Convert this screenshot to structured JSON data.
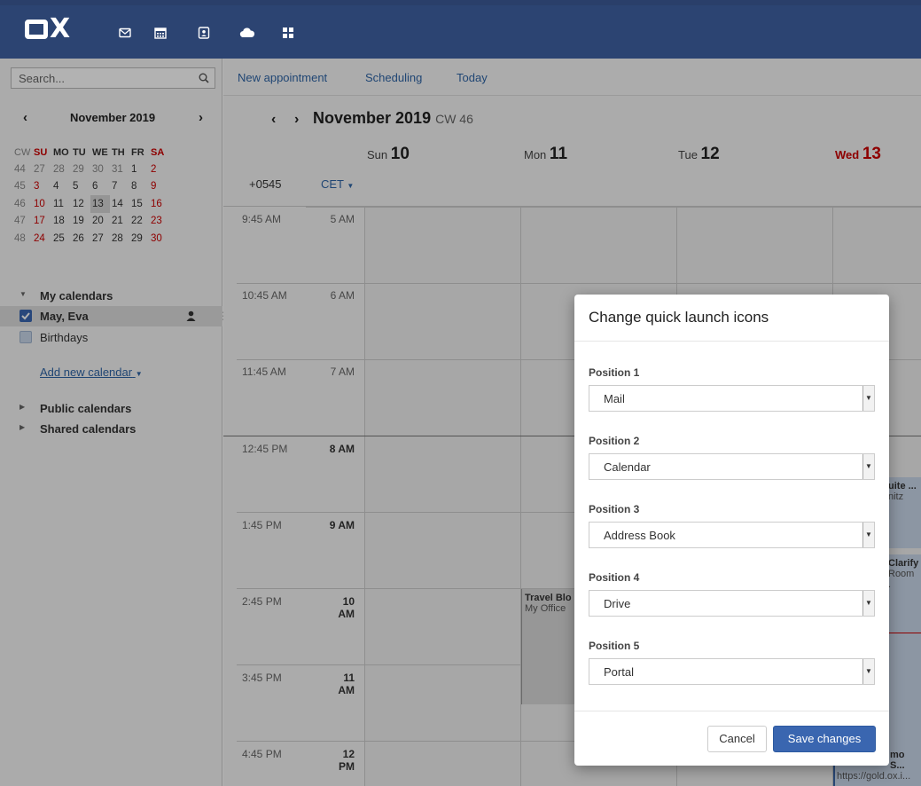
{
  "app": {
    "logo_text": "X"
  },
  "topbar": {
    "quick_icons": [
      "mail-icon",
      "calendar-icon",
      "address-book-icon",
      "cloud-icon",
      "apps-grid-icon"
    ],
    "colors": {
      "bar": "#2c4472",
      "icon": "#ffffff"
    }
  },
  "sidebar": {
    "search_placeholder": "Search...",
    "mini_calendar": {
      "month_label": "November 2019",
      "headers": [
        "CW",
        "SU",
        "MO",
        "TU",
        "WE",
        "TH",
        "FR",
        "SA"
      ],
      "weeks": [
        {
          "cw": "44",
          "days": [
            "27",
            "28",
            "29",
            "30",
            "31",
            "1",
            "2"
          ]
        },
        {
          "cw": "45",
          "days": [
            "3",
            "4",
            "5",
            "6",
            "7",
            "8",
            "9"
          ]
        },
        {
          "cw": "46",
          "days": [
            "10",
            "11",
            "12",
            "13",
            "14",
            "15",
            "16"
          ]
        },
        {
          "cw": "47",
          "days": [
            "17",
            "18",
            "19",
            "20",
            "21",
            "22",
            "23"
          ]
        },
        {
          "cw": "48",
          "days": [
            "24",
            "25",
            "26",
            "27",
            "28",
            "29",
            "30"
          ]
        }
      ],
      "today": "13"
    },
    "my_calendars_label": "My calendars",
    "calendars": [
      {
        "name": "May, Eva",
        "checked": true,
        "color": "#3a66b0"
      },
      {
        "name": "Birthdays",
        "checked": false,
        "color": "#c9d7ea"
      }
    ],
    "add_calendar_label": "Add new calendar",
    "public_calendars_label": "Public calendars",
    "shared_calendars_label": "Shared calendars"
  },
  "toolbar": {
    "new_appointment": "New appointment",
    "scheduling": "Scheduling",
    "today": "Today"
  },
  "calendar": {
    "title": "November 2019",
    "cw": "CW 46",
    "timezone_1": "+0545",
    "timezone_2": "CET",
    "days": [
      {
        "name": "Sun",
        "num": "10",
        "today": false
      },
      {
        "name": "Mon",
        "num": "11",
        "today": false
      },
      {
        "name": "Tue",
        "num": "12",
        "today": false
      },
      {
        "name": "Wed",
        "num": "13",
        "today": true
      }
    ],
    "hours": [
      {
        "local": "9:45 AM",
        "cet": "5 AM",
        "work": false
      },
      {
        "local": "10:45 AM",
        "cet": "6 AM",
        "work": false
      },
      {
        "local": "11:45 AM",
        "cet": "7 AM",
        "work": false
      },
      {
        "local": "12:45 PM",
        "cet": "8 AM",
        "work": true
      },
      {
        "local": "1:45 PM",
        "cet": "9 AM",
        "work": true
      },
      {
        "local": "2:45 PM",
        "cet": "10 AM",
        "work": true
      },
      {
        "local": "3:45 PM",
        "cet": "11 AM",
        "work": true
      },
      {
        "local": "4:45 PM",
        "cet": "12 PM",
        "work": true
      }
    ],
    "events": [
      {
        "title": "Travel Blo",
        "location": "My Office"
      },
      {
        "title": "uite ...",
        "location": "nitz"
      },
      {
        "title": "Clarify",
        "location": "Room ."
      },
      {
        "title": "mo S...",
        "location": "https://gold.ox.i..."
      }
    ]
  },
  "dialog": {
    "title": "Change quick launch icons",
    "positions": [
      {
        "label": "Position 1",
        "value": "Mail"
      },
      {
        "label": "Position 2",
        "value": "Calendar"
      },
      {
        "label": "Position 3",
        "value": "Address Book"
      },
      {
        "label": "Position 4",
        "value": "Drive"
      },
      {
        "label": "Position 5",
        "value": "Portal"
      }
    ],
    "cancel_label": "Cancel",
    "save_label": "Save changes",
    "colors": {
      "primary": "#3a66b0"
    }
  }
}
